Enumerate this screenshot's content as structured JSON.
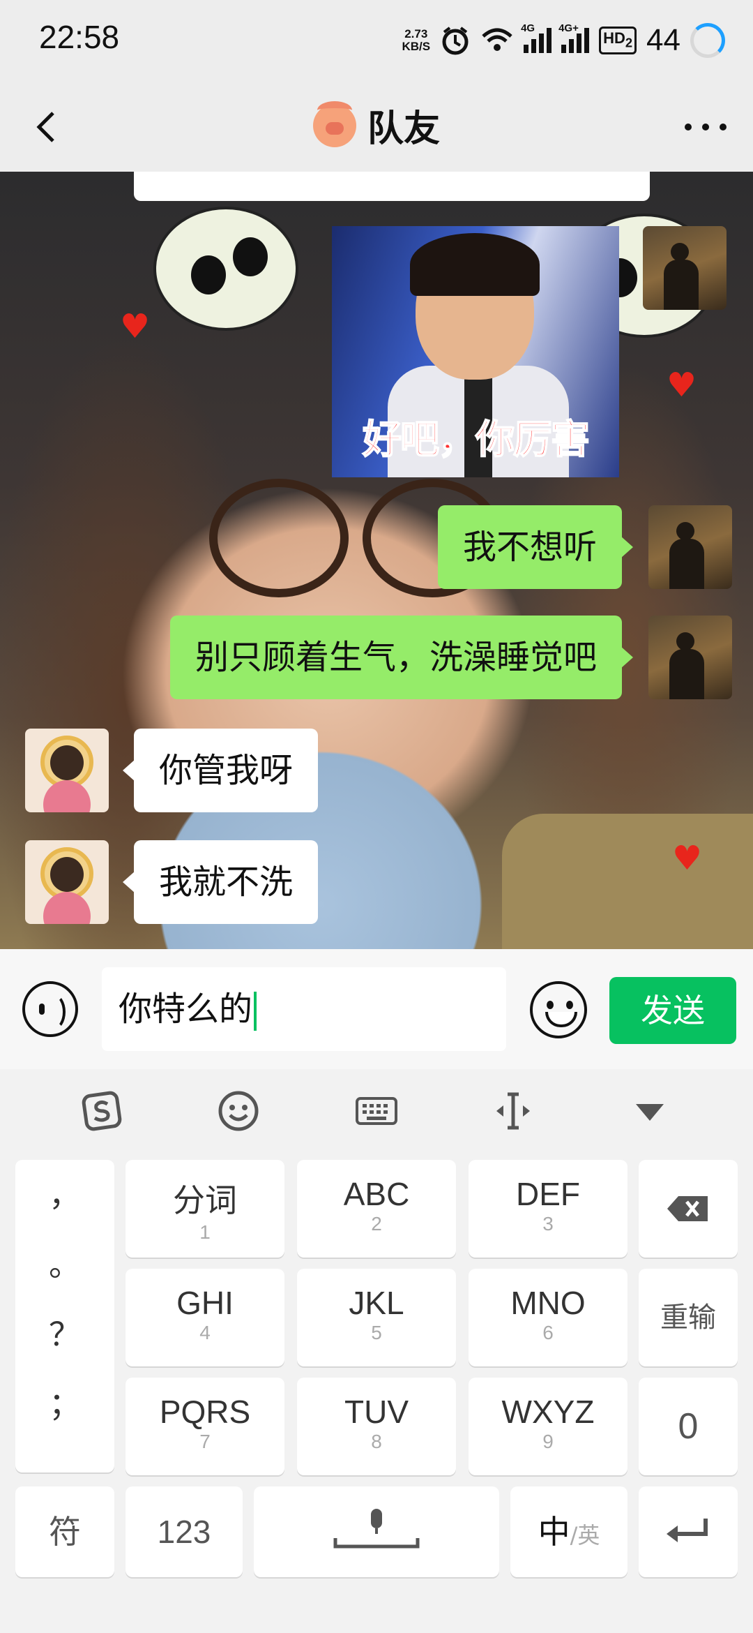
{
  "status_bar": {
    "time": "22:58",
    "net_speed_value": "2.73",
    "net_speed_unit": "KB/S",
    "sim1": "4G",
    "sim2": "4G+",
    "hd": "HD",
    "hd_sub": "2",
    "battery": "44"
  },
  "nav": {
    "title": "队友",
    "title_icon": "pig-face-icon"
  },
  "chat": {
    "sticker_caption": "好吧，你厉害",
    "messages": [
      {
        "side": "me",
        "text": "我不想听"
      },
      {
        "side": "me",
        "text": "别只顾着生气，洗澡睡觉吧"
      },
      {
        "side": "other",
        "text": "你管我呀"
      },
      {
        "side": "other",
        "text": "我就不洗"
      }
    ]
  },
  "input": {
    "value": "你特么的",
    "send_label": "发送"
  },
  "keyboard": {
    "punct": [
      "，",
      "。",
      "？",
      "；"
    ],
    "keys": [
      {
        "main": "分词",
        "sub": "1"
      },
      {
        "main": "ABC",
        "sub": "2"
      },
      {
        "main": "DEF",
        "sub": "3"
      },
      {
        "main": "GHI",
        "sub": "4"
      },
      {
        "main": "JKL",
        "sub": "5"
      },
      {
        "main": "MNO",
        "sub": "6"
      },
      {
        "main": "PQRS",
        "sub": "7"
      },
      {
        "main": "TUV",
        "sub": "8"
      },
      {
        "main": "WXYZ",
        "sub": "9"
      }
    ],
    "reinput": "重输",
    "zero": "0",
    "symbols": "符",
    "num": "123",
    "lang_main": "中",
    "lang_sub": "/英"
  },
  "colors": {
    "accent": "#07c160",
    "my_bubble": "#95ec69",
    "their_bubble": "#ffffff"
  }
}
